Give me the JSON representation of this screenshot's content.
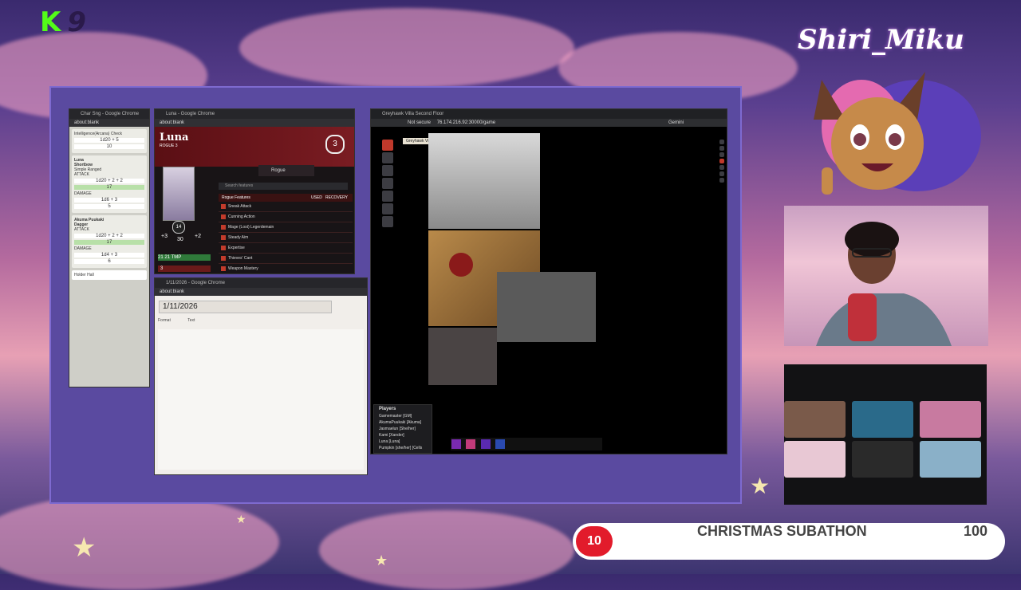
{
  "overlay": {
    "kick_letter": "K",
    "kick_number": "9",
    "brand_name": "Shiri_Miku"
  },
  "left_window": {
    "title": "Char Sng - Google Chrome",
    "url": "about:blank",
    "check_label": "Intelligence(Arcana) Check",
    "total_1": "1d20 + 5",
    "result_1": "10",
    "card1_name": "Luna",
    "item1": "Shortbow",
    "item1_sub": "Simple Ranged",
    "attack_label": "ATTACK",
    "attack_1": "1d20 + 2 + 2",
    "attack_result_1": "17",
    "damage_label": "DAMAGE",
    "damage_1": "1d6 + 3",
    "damage_result_1": "5",
    "card2_name": "Akuma Puukaki",
    "item2": "Dagger",
    "attack_2": "1d20 + 2 + 2",
    "attack_result_2": "17",
    "damage_2": "1d4 + 3",
    "damage_result_2": "6",
    "select_value": "Holder Hall"
  },
  "luna_window": {
    "title": "Luna - Google Chrome",
    "url": "about:blank",
    "name": "Luna",
    "class": "ROGUE 3",
    "level": "3",
    "portrait_level": "14",
    "stat_left": "+3",
    "stat_mid": "30",
    "stat_right": "+2",
    "hp_current": "21",
    "hp_max": "21",
    "hp_label": "TMP",
    "hit_dice": "3",
    "item_name": "Rogue",
    "search_placeholder": "Search features",
    "features_header": "Rogue Features",
    "col_used": "USED",
    "col_recovery": "RECOVERY",
    "features": [
      {
        "name": "Sneak Attack"
      },
      {
        "name": "Cunning Action"
      },
      {
        "name": "Mage (Lost) Legerdemain"
      },
      {
        "name": "Steady Aim"
      },
      {
        "name": "Expertise"
      },
      {
        "name": "Thieves' Cant"
      },
      {
        "name": "Weapon Mastery"
      }
    ]
  },
  "notes_window": {
    "title": "1/11/2026 - Google Chrome",
    "url": "about:blank",
    "heading": "1/11/2026",
    "format_label": "Format",
    "text_label": "Text"
  },
  "vtt_window": {
    "tab_title": "Greyhawk Villa Second Floor",
    "url": "76.174.216.92:30000/game",
    "not_secure": "Not secure",
    "scene_label": "Greyhawk Villa Second Floor",
    "gemini": "Gemini",
    "players_title": "Players",
    "players": [
      "Gamemaster [GM]",
      "AkumaPuukaki [Akuma]",
      "Jasmaelun [She/her]",
      "Kami [Xander]",
      "Luna [Luna]",
      "Pumpkin [she/her] [Cells"
    ]
  },
  "subathon": {
    "left_value": "10",
    "title": "CHRISTMAS SUBATHON",
    "right_value": "100"
  },
  "colors": {
    "accent_red": "#e21b2b",
    "kick_green": "#53fc18",
    "frame_purple": "#5a4aa0"
  }
}
